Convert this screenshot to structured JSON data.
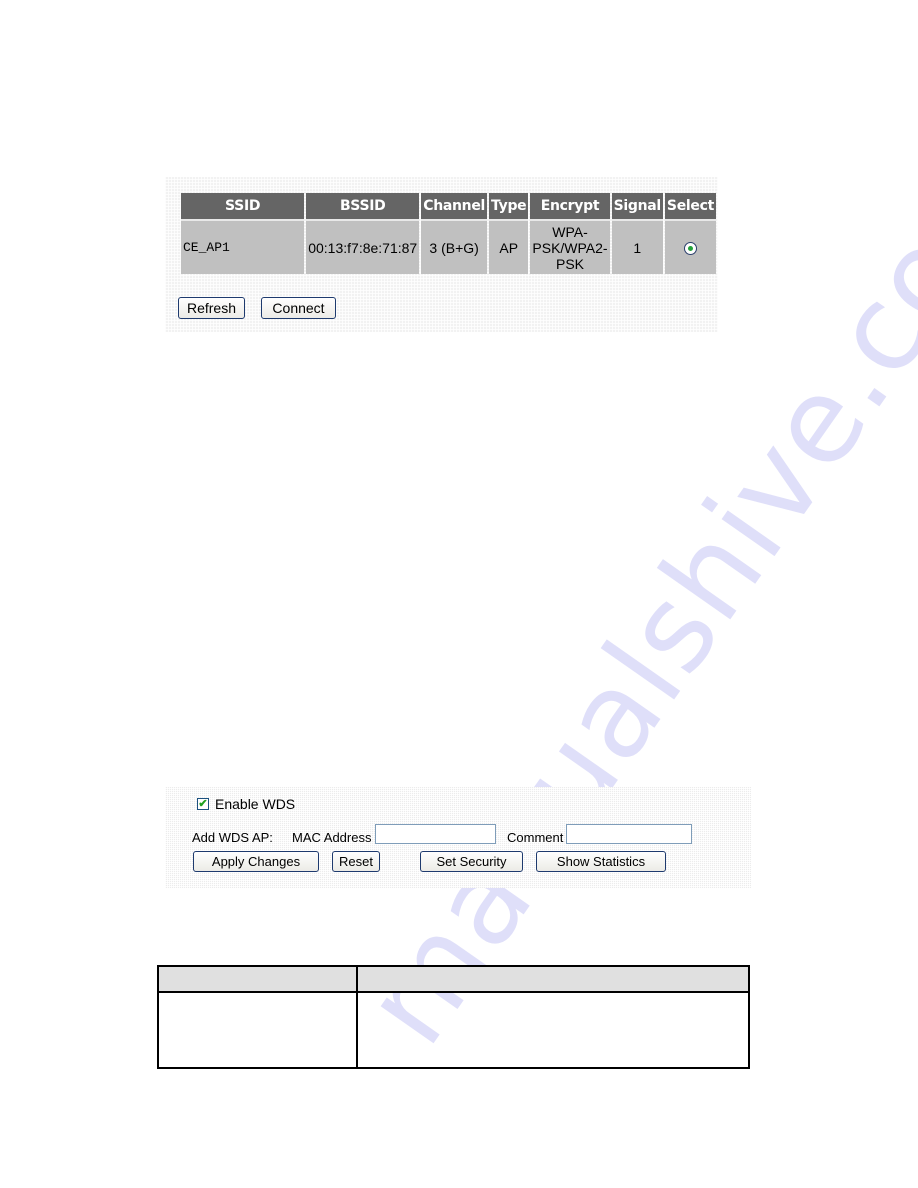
{
  "site_survey": {
    "columns": [
      "SSID",
      "BSSID",
      "Channel",
      "Type",
      "Encrypt",
      "Signal",
      "Select"
    ],
    "rows": [
      {
        "ssid": "CE_AP1",
        "bssid": "00:13:f7:8e:71:87",
        "channel": "3 (B+G)",
        "type": "AP",
        "encrypt_lines": [
          "WPA-",
          "PSK/WPA2-",
          "PSK"
        ],
        "signal": "1",
        "selected": true
      }
    ],
    "buttons": {
      "refresh": "Refresh",
      "connect": "Connect"
    }
  },
  "wds": {
    "enable_label": "Enable WDS",
    "enabled": true,
    "add_ap_label": "Add WDS AP:",
    "mac_label": "MAC Address",
    "mac_value": "",
    "comment_label": "Comment",
    "comment_value": "",
    "buttons": {
      "apply": "Apply Changes",
      "reset": "Reset",
      "security": "Set Security",
      "statistics": "Show Statistics"
    }
  },
  "description_table": {
    "headers": [
      "",
      ""
    ],
    "rows": [
      [
        "",
        ""
      ]
    ]
  },
  "watermark": "manualshive.com",
  "colors": {
    "header_bg": "#656565",
    "cell_bg": "#c0c0c0",
    "radio_dot": "#23a23a",
    "button_border": "#1e3a6e",
    "check": "#21a121"
  }
}
